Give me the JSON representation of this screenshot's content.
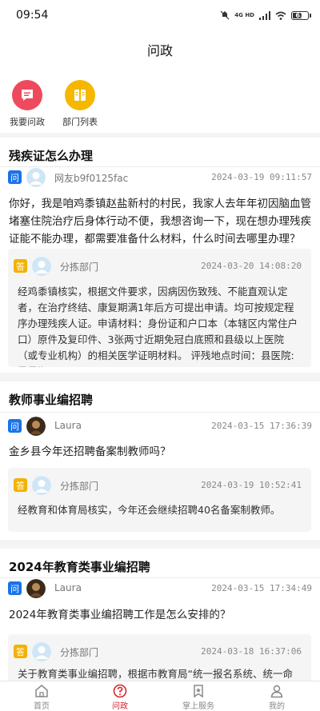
{
  "status_bar": {
    "time": "09:54",
    "network": "4G HD",
    "battery": "63"
  },
  "header": {
    "title": "问政"
  },
  "quick_actions": [
    {
      "label": "我要问政",
      "icon": "chat-icon",
      "color": "#ee4a5e"
    },
    {
      "label": "部门列表",
      "icon": "book-icon",
      "color": "#f5b700"
    }
  ],
  "tags": {
    "question": "问",
    "answer": "答"
  },
  "questions": [
    {
      "title": "残疾证怎么办理",
      "asker": "网友b9f0125fac",
      "asked_at": "2024-03-19 09:11:57",
      "content": "你好，我是咱鸡黍镇赵盐新村的村民，我家人去年年初因脑血管堵塞住院治疗后身体行动不便，我想咨询一下，现在想办理残疾证能不能办理，都需要准备什么材料，什么时间去哪里办理？",
      "answer": {
        "department": "分拣部门",
        "answered_at": "2024-03-20 14:08:20",
        "content": "经鸡黍镇核实，根据文件要求，因病因伤致残、不能直观认定者，在治疗终结、康复期满1年后方可提出申请。均可按规定程序办理残疾人证。申请材料：身份证和户口本（本辖区内常住户口）原件及复印件、3张两寸近期免冠白底照和县级以上医院（或专业机构）的相关医学证明材料。 评残地点时间：县医院:是星期二..."
      }
    },
    {
      "title": "教师事业编招聘",
      "asker": "Laura",
      "asked_at": "2024-03-15 17:36:39",
      "content": "金乡县今年还招聘备案制教师吗？",
      "answer": {
        "department": "分拣部门",
        "answered_at": "2024-03-19 10:52:41",
        "content": "经教育和体育局核实，今年还会继续招聘40名备案制教师。"
      }
    },
    {
      "title": "2024年教育类事业编招聘",
      "asker": "Laura",
      "asked_at": "2024-03-15 17:34:49",
      "content": "2024年教育类事业编招聘工作是怎么安排的？",
      "answer": {
        "department": "分拣部门",
        "answered_at": "2024-03-18 16:37:06",
        "content": "关于教育类事业编招聘，根据市教育局“统一报名系统、统一命"
      }
    }
  ],
  "tab_bar": [
    {
      "label": "首页",
      "icon": "home-icon"
    },
    {
      "label": "问政",
      "icon": "question-icon",
      "active": true
    },
    {
      "label": "掌上服务",
      "icon": "bookmark-icon"
    },
    {
      "label": "我的",
      "icon": "user-icon"
    }
  ],
  "colors": {
    "accent": "#d6262c",
    "question_tag": "#1a73e8",
    "answer_tag": "#f3b100"
  }
}
